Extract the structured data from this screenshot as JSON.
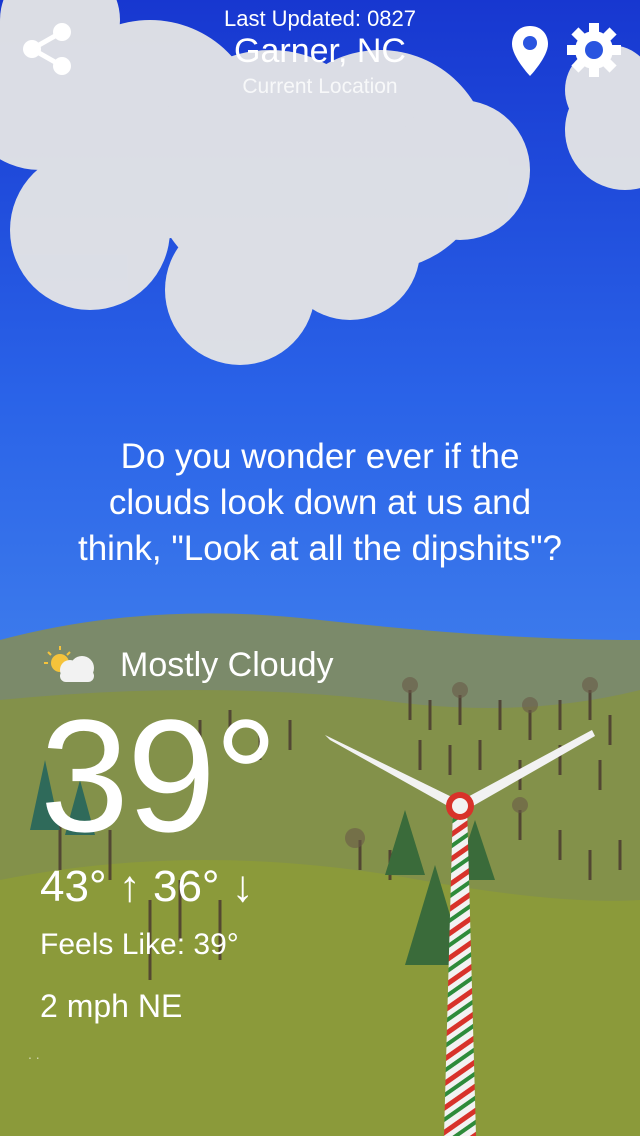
{
  "header": {
    "last_updated": "Last Updated: 0827",
    "city": "Garner, NC",
    "location_type": "Current Location"
  },
  "icons": {
    "share": "share-icon",
    "location": "location-pin-icon",
    "settings": "gear-icon",
    "condition": "partly-cloudy-icon"
  },
  "quote": {
    "line1": "Do you wonder ever if the",
    "line2": "clouds look down at us and",
    "line3": "think, \"Look at all the dipshits\"?"
  },
  "weather": {
    "condition": "Mostly Cloudy",
    "temperature": "39°",
    "high_low": "43° ↑  36° ↓",
    "feels_like": "Feels Like: 39°",
    "wind": "2 mph NE",
    "footer_dots": ". ."
  },
  "colors": {
    "sky_top": "#1a3fd4",
    "sky_bottom": "#5aa2f2",
    "hill_far": "#7f8f5a",
    "hill_near": "#8c9b3c"
  }
}
